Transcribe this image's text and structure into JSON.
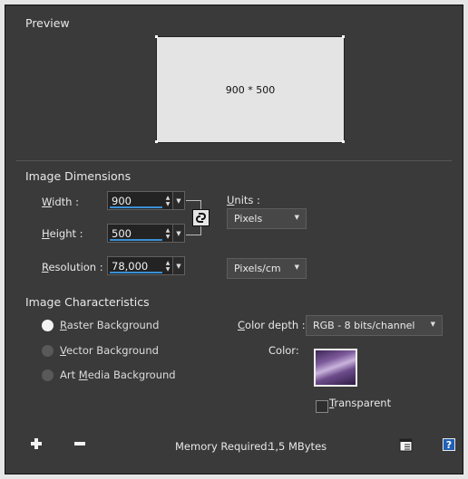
{
  "preview": {
    "title": "Preview",
    "size_text": "900 * 500"
  },
  "dimensions": {
    "title": "Image Dimensions",
    "width_label_key": "W",
    "width_label_rest": "idth :",
    "height_label_key": "H",
    "height_label_rest": "eight :",
    "resolution_label_key": "R",
    "resolution_label_rest": "esolution :",
    "width_value": "900",
    "height_value": "500",
    "resolution_value": "78,000",
    "units_label_key": "U",
    "units_label_rest": "nits :",
    "units_value": "Pixels",
    "resolution_units_value": "Pixels/cm"
  },
  "characteristics": {
    "title": "Image Characteristics",
    "options": [
      {
        "key": "R",
        "rest": "aster Background",
        "selected": true
      },
      {
        "key": "V",
        "rest": "ector Background",
        "selected": false
      },
      {
        "prefix": "Art ",
        "key": "M",
        "rest": "edia Background",
        "selected": false
      }
    ],
    "color_depth_label_key": "C",
    "color_depth_label_rest": "olor depth :",
    "color_depth_value": "RGB - 8 bits/channel",
    "color_label": "Color:",
    "transparent_key": "T",
    "transparent_rest": "ransparent",
    "transparent_checked": false
  },
  "footer": {
    "memory_label": "Memory Required:",
    "memory_value": "1,5 MBytes",
    "add_icon": "plus-icon",
    "remove_icon": "minus-icon",
    "notes_icon": "notes-icon",
    "help_icon": "help-icon"
  },
  "colors": {
    "accent": "#3a8fd6",
    "panel_bg": "#3a3a3a"
  }
}
